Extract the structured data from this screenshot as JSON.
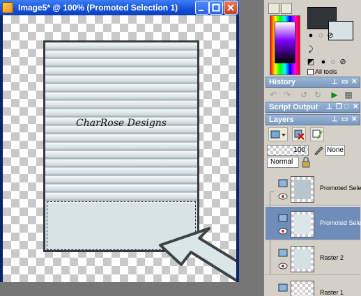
{
  "window": {
    "title": "Image5* @ 100% (Promoted Selection 1)",
    "controls": [
      "minimize-icon",
      "maximize-icon",
      "close-icon"
    ]
  },
  "canvas": {
    "card_text": "CharRose Designs",
    "colors": {
      "frame": "#353b3f",
      "fill": "#d8e3e7",
      "stripe_light": "#f6f9fa",
      "stripe_dark": "#9eabb1"
    }
  },
  "materials": {
    "foreground_color": "#2f3438",
    "background_color": "#d7e2e6",
    "all_tools_label": "All tools"
  },
  "palettes": {
    "history": "History",
    "script_output": "Script Output",
    "layers": "Layers"
  },
  "layers_panel": {
    "opacity": "100",
    "mask": "None",
    "blend_mode": "Normal",
    "items": [
      {
        "name": "Promoted Select",
        "selected": false,
        "fill": "#b7c6cc"
      },
      {
        "name": "Promoted Select",
        "selected": true,
        "fill": "#dce6ea"
      },
      {
        "name": "Raster 2",
        "selected": false,
        "fill": "#d3e0e4"
      },
      {
        "name": "Raster 1",
        "selected": false,
        "fill": ""
      }
    ]
  },
  "accent_colors": {
    "titlebar": "#1450d9",
    "palette_header": "#7b98bf",
    "selected_layer": "#6f8db8"
  }
}
